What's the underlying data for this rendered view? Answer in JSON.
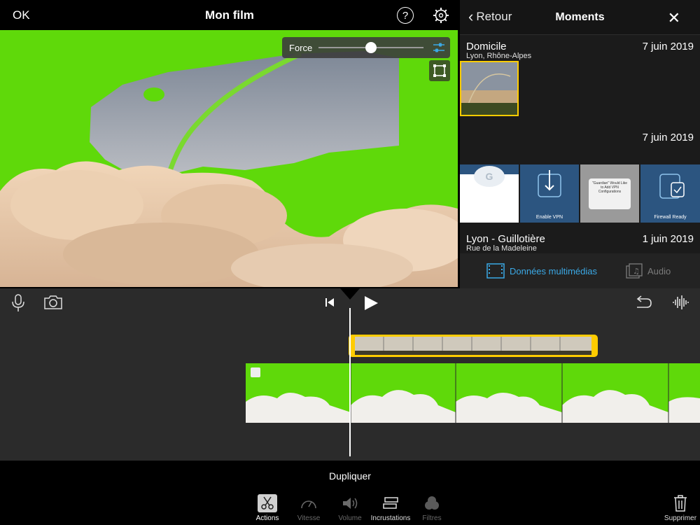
{
  "topbar": {
    "ok_label": "OK",
    "title": "Mon film",
    "help_icon": "question-icon",
    "settings_icon": "gear-icon"
  },
  "viewer": {
    "force_label": "Force",
    "force_value": 0.5,
    "adjust_icon": "sliders-icon",
    "crop_icon": "crop-icon"
  },
  "panel": {
    "back_label": "Retour",
    "title": "Moments",
    "close_icon": "close-icon",
    "moments": [
      {
        "title": "Domicile",
        "subtitle": "Lyon, Rhône-Alpes",
        "date": "7 juin 2019"
      },
      {
        "title": "",
        "subtitle": "",
        "date": "7 juin 2019"
      },
      {
        "title": "Lyon - Guillotière",
        "subtitle": "Rue de la Madeleine",
        "date": "1 juin 2019"
      }
    ],
    "thumbs": [
      {
        "caption": ""
      },
      {
        "caption": "Enable VPN"
      },
      {
        "caption": "\"Guardian\" Would Like to Add VPN Configurations"
      },
      {
        "caption": "Firewall Ready"
      }
    ],
    "footer": {
      "media_label": "Données multimédias",
      "audio_label": "Audio",
      "accent": "#3ba9e6"
    }
  },
  "timeline": {
    "mic_icon": "microphone-icon",
    "camera_icon": "camera-icon",
    "skip_back_icon": "skip-back-icon",
    "play_icon": "play-icon",
    "undo_icon": "undo-icon",
    "waveform_icon": "waveform-icon",
    "clip_accent": "#ffcc00"
  },
  "bottombar": {
    "action_title": "Dupliquer",
    "tools": [
      {
        "label": "Actions",
        "icon": "scissors-icon",
        "active": true
      },
      {
        "label": "Vitesse",
        "icon": "speedometer-icon",
        "active": false
      },
      {
        "label": "Volume",
        "icon": "speaker-icon",
        "active": false
      },
      {
        "label": "Incrustations",
        "icon": "overlay-icon",
        "active": false
      },
      {
        "label": "Filtres",
        "icon": "filters-icon",
        "active": false
      }
    ],
    "delete_label": "Supprimer",
    "delete_icon": "trash-icon"
  }
}
